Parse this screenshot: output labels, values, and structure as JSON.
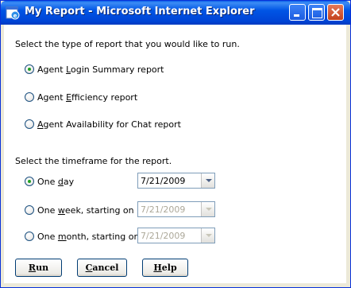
{
  "window": {
    "title": "My Report - Microsoft Internet Explorer"
  },
  "report_type": {
    "prompt": "Select the type of report that you would like to run.",
    "options": [
      {
        "pre": "Agent ",
        "key": "L",
        "post": "ogin Summary report",
        "checked": true
      },
      {
        "pre": "Agent ",
        "key": "E",
        "post": "fficiency report",
        "checked": false
      },
      {
        "pre": "",
        "key": "A",
        "post": "gent Availability for Chat report",
        "checked": false
      }
    ]
  },
  "timeframe": {
    "prompt": "Select the timeframe for the report.",
    "options": [
      {
        "pre": "One ",
        "key": "d",
        "post": "ay",
        "checked": true,
        "date": "7/21/2009",
        "enabled": true
      },
      {
        "pre": "One ",
        "key": "w",
        "post": "eek, starting on",
        "checked": false,
        "date": "7/21/2009",
        "enabled": false
      },
      {
        "pre": "One ",
        "key": "m",
        "post": "onth, starting on",
        "checked": false,
        "date": "7/21/2009",
        "enabled": false
      }
    ]
  },
  "buttons": {
    "run": {
      "key": "R",
      "rest": "un"
    },
    "cancel": {
      "key": "C",
      "rest": "ancel"
    },
    "help": {
      "key": "H",
      "rest": "elp"
    }
  },
  "colors": {
    "titlebar": "#0055e5",
    "radio_dot": "#21a121",
    "close_button": "#c3401b"
  }
}
